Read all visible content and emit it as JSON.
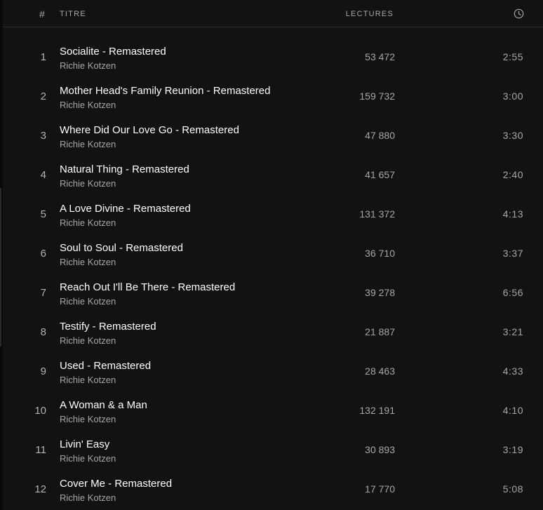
{
  "header": {
    "number_label": "#",
    "title_label": "TITRE",
    "plays_label": "LECTURES",
    "duration_icon": "clock-icon"
  },
  "tracks": [
    {
      "number": "1",
      "title": "Socialite - Remastered",
      "artist": "Richie Kotzen",
      "plays": "53 472",
      "duration": "2:55"
    },
    {
      "number": "2",
      "title": "Mother Head's Family Reunion - Remastered",
      "artist": "Richie Kotzen",
      "plays": "159 732",
      "duration": "3:00"
    },
    {
      "number": "3",
      "title": "Where Did Our Love Go - Remastered",
      "artist": "Richie Kotzen",
      "plays": "47 880",
      "duration": "3:30"
    },
    {
      "number": "4",
      "title": "Natural Thing - Remastered",
      "artist": "Richie Kotzen",
      "plays": "41 657",
      "duration": "2:40"
    },
    {
      "number": "5",
      "title": "A Love Divine - Remastered",
      "artist": "Richie Kotzen",
      "plays": "131 372",
      "duration": "4:13"
    },
    {
      "number": "6",
      "title": "Soul to Soul - Remastered",
      "artist": "Richie Kotzen",
      "plays": "36 710",
      "duration": "3:37"
    },
    {
      "number": "7",
      "title": "Reach Out I'll Be There - Remastered",
      "artist": "Richie Kotzen",
      "plays": "39 278",
      "duration": "6:56"
    },
    {
      "number": "8",
      "title": "Testify - Remastered",
      "artist": "Richie Kotzen",
      "plays": "21 887",
      "duration": "3:21"
    },
    {
      "number": "9",
      "title": "Used - Remastered",
      "artist": "Richie Kotzen",
      "plays": "28 463",
      "duration": "4:33"
    },
    {
      "number": "10",
      "title": "A Woman & a Man",
      "artist": "Richie Kotzen",
      "plays": "132 191",
      "duration": "4:10"
    },
    {
      "number": "11",
      "title": "Livin' Easy",
      "artist": "Richie Kotzen",
      "plays": "30 893",
      "duration": "3:19"
    },
    {
      "number": "12",
      "title": "Cover Me - Remastered",
      "artist": "Richie Kotzen",
      "plays": "17 770",
      "duration": "5:08"
    }
  ],
  "colors": {
    "background": "#121212",
    "primary_text": "#ffffff",
    "secondary_text": "#a7a7a7",
    "divider": "#2a2a2a"
  }
}
